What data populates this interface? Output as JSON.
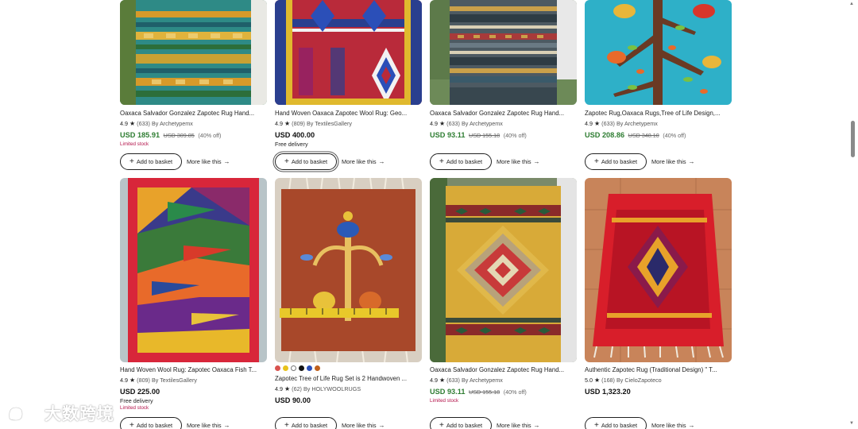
{
  "basket_label": "Add to basket",
  "more_like_label": "More like this",
  "products": [
    {
      "title": "Oaxaca Salvador Gonzalez Zapotec Rug Hand...",
      "score": "4.9",
      "reviews": "(633)",
      "seller": "By Archetypemx",
      "price": "USD 185.91",
      "orig": "USD 309.85",
      "pct": "(40% off)",
      "notes": [
        "Limited stock"
      ]
    },
    {
      "title": "Hand Woven Oaxaca Zapotec Wool Rug: Geo...",
      "score": "4.9",
      "reviews": "(809)",
      "seller": "By TextilesGallery",
      "price": "USD 400.00",
      "notes": [
        "Free delivery"
      ]
    },
    {
      "title": "Oaxaca Salvador Gonzalez Zapotec Rug Hand...",
      "score": "4.9",
      "reviews": "(633)",
      "seller": "By Archetypemx",
      "price": "USD 93.11",
      "orig": "USD 155.18",
      "pct": "(40% off)",
      "notes": []
    },
    {
      "title": "Zapotec Rug,Oaxaca Rugs,Tree of Life Design,...",
      "score": "4.9",
      "reviews": "(633)",
      "seller": "By Archetypemx",
      "price": "USD 208.86",
      "orig": "USD 348.10",
      "pct": "(40% off)",
      "notes": []
    },
    {
      "title": "Hand Woven Wool Rug: Zapotec Oaxaca Fish T...",
      "score": "4.9",
      "reviews": "(809)",
      "seller": "By TextilesGallery",
      "price": "USD 225.00",
      "notes": [
        "Free delivery",
        "Limited stock"
      ]
    },
    {
      "title": "Zapotec Tree of Life Rug Set is 2 Handwoven ...",
      "score": "4.9",
      "reviews": "(62)",
      "seller": "By HOLYWOOLRUGS",
      "price": "USD 90.00",
      "notes": [],
      "swatches": [
        "#d9534f",
        "#e8c21a",
        "#ffffff",
        "#111111",
        "#2b4fb8",
        "#c0601c"
      ]
    },
    {
      "title": "Oaxaca Salvador Gonzalez Zapotec Rug Hand...",
      "score": "4.9",
      "reviews": "(633)",
      "seller": "By Archetypemx",
      "price": "USD 93.11",
      "orig": "USD 155.18",
      "pct": "(40% off)",
      "notes": [
        "Limited stock"
      ]
    },
    {
      "title": "Authentic Zapotec Rug (Traditional Design) \" T...",
      "score": "5.0",
      "reviews": "(168)",
      "seller": "By CieloZapoteco",
      "price": "USD 1,323.20",
      "notes": []
    }
  ],
  "watermark": "大数跨境"
}
